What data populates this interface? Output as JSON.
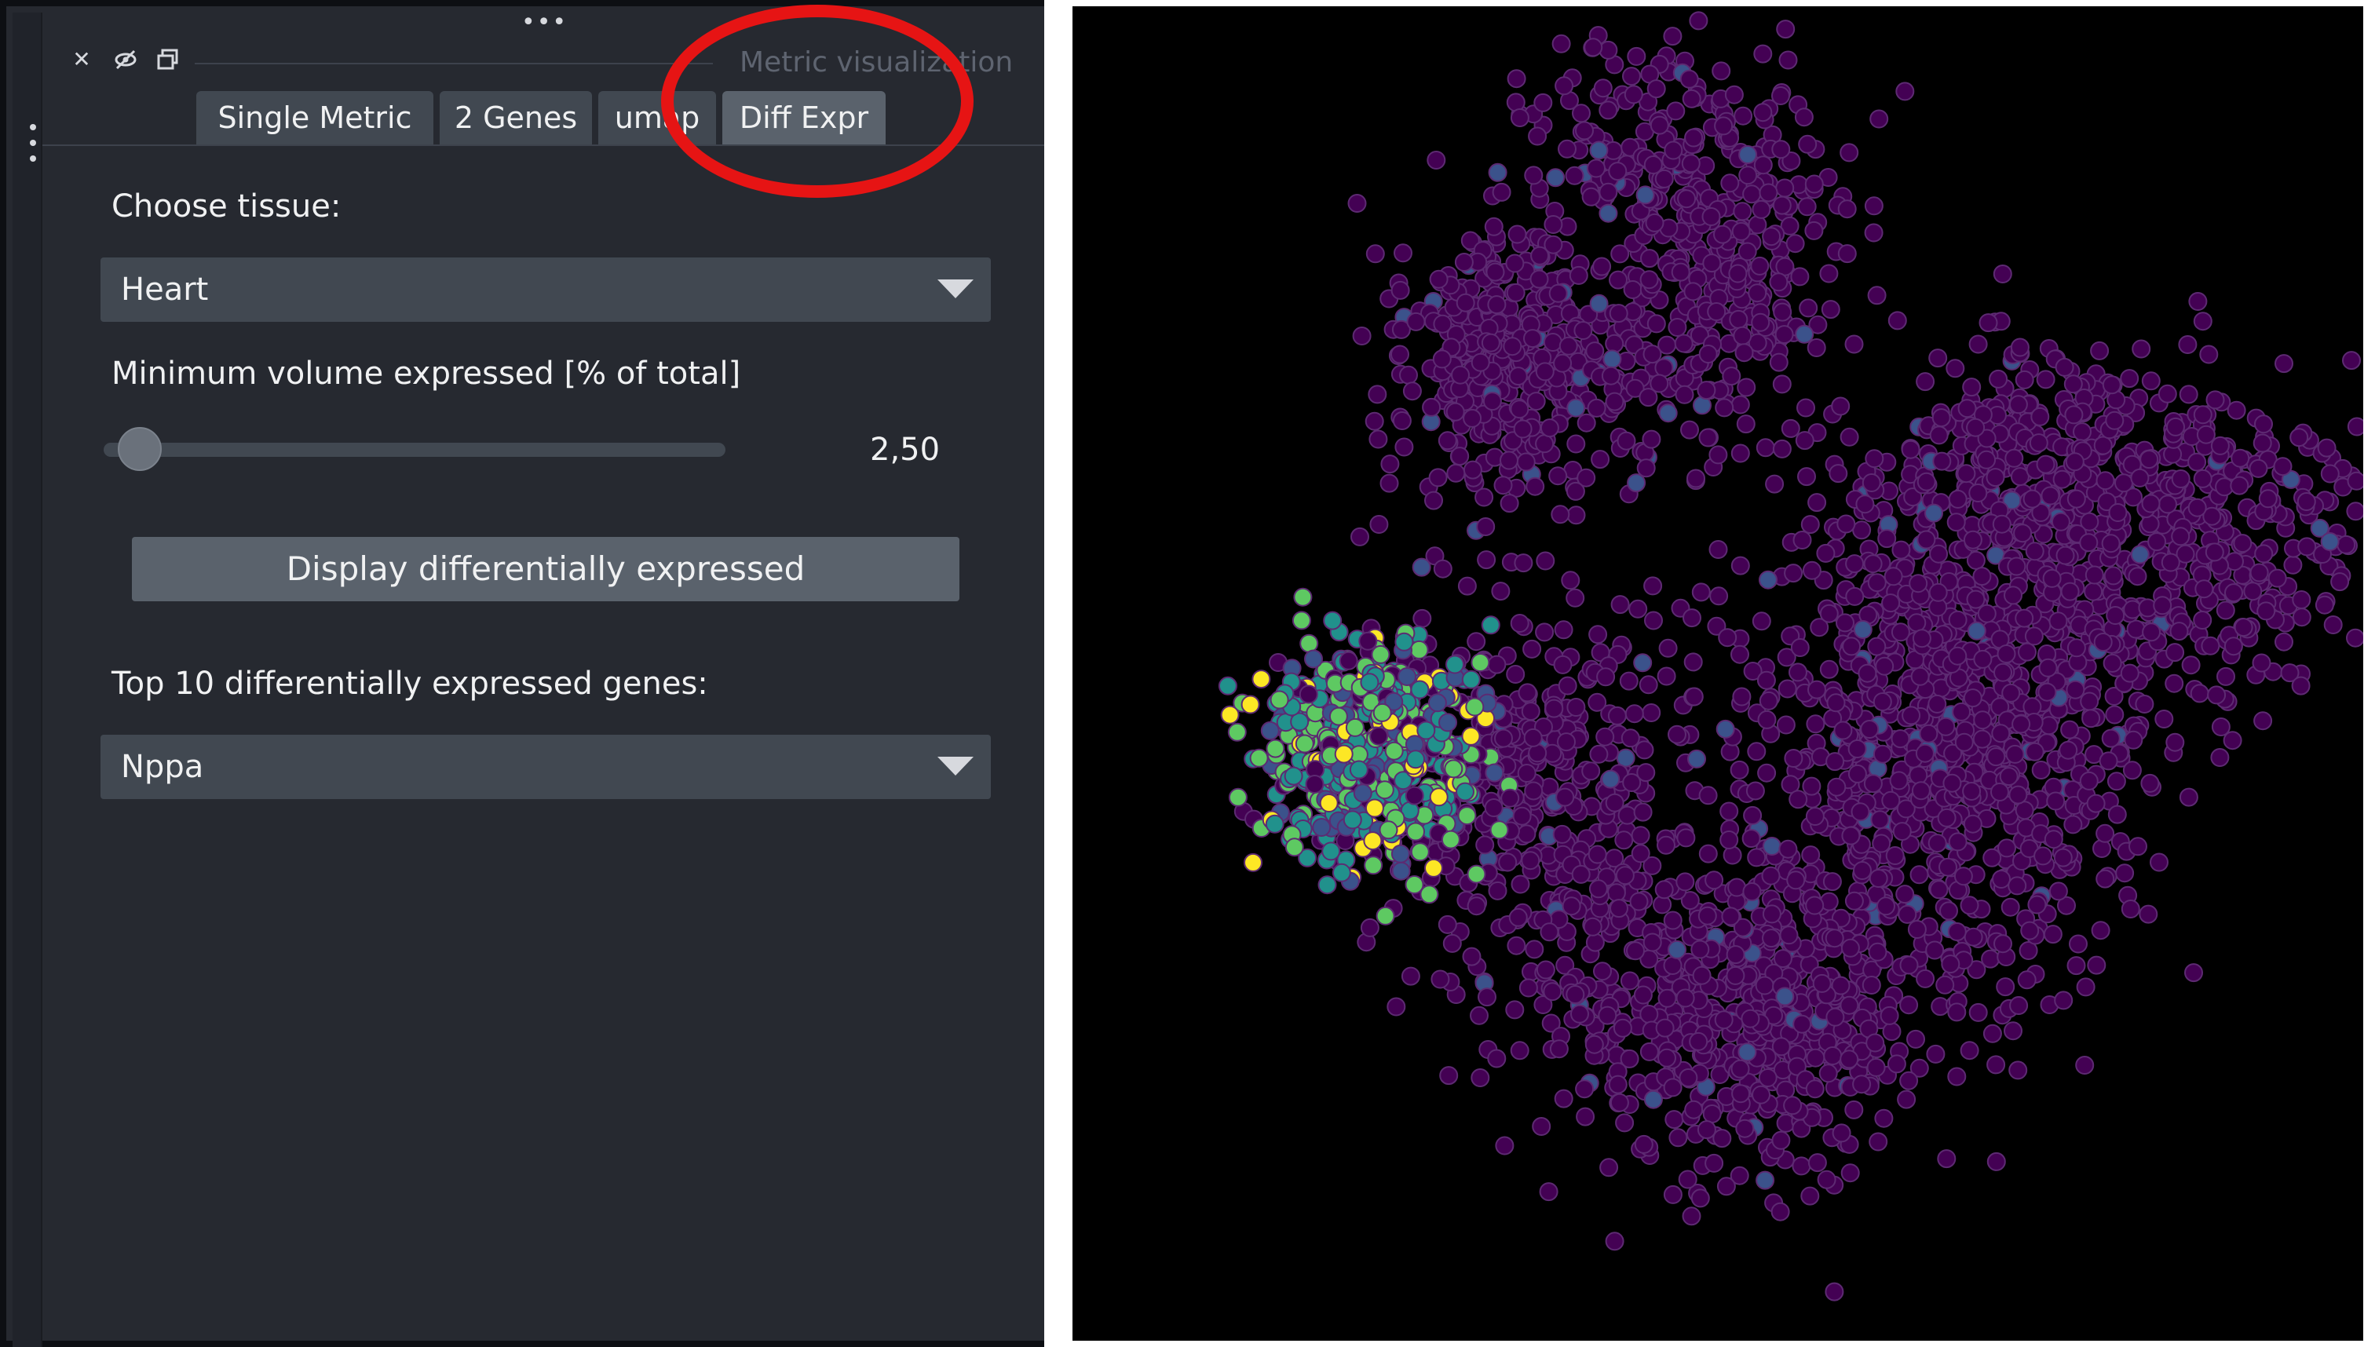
{
  "panel": {
    "title": "Metric visualization",
    "tabs": [
      {
        "label": "Single Metric",
        "active": false
      },
      {
        "label": "2 Genes",
        "active": false
      },
      {
        "label": "umap",
        "active": false
      },
      {
        "label": "Diff Expr",
        "active": true
      }
    ],
    "tissue": {
      "label": "Choose tissue:",
      "selected": "Heart"
    },
    "volume": {
      "label": "Minimum volume expressed [% of total]",
      "value_text": "2,50",
      "level_fraction": 0.025
    },
    "display_button": "Display differentially expressed",
    "top_genes": {
      "label": "Top 10 differentially expressed genes:",
      "selected": "Nppa"
    },
    "icons": {
      "close": "close-icon",
      "hide": "eye-slash-icon",
      "float": "float-window-icon"
    }
  },
  "annotation": {
    "shape": "ellipse",
    "color": "#e61414"
  },
  "viewer": {
    "background": "#000000",
    "colormap": [
      "#440154",
      "#3b528b",
      "#21918c",
      "#5ec962",
      "#fde725"
    ],
    "dominant_color": "#440154"
  }
}
